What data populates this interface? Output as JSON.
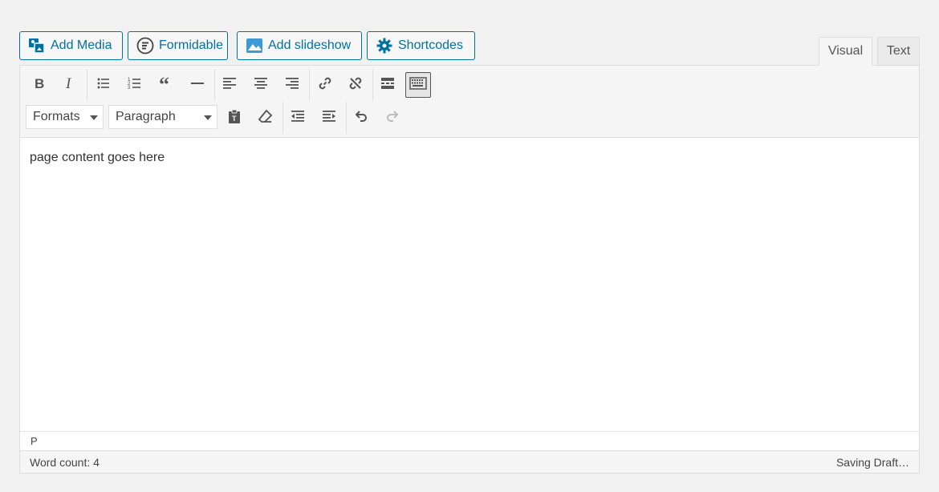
{
  "media_buttons": {
    "add_media": "Add Media",
    "formidable": "Formidable",
    "add_slideshow": "Add slideshow",
    "shortcodes": "Shortcodes"
  },
  "tabs": {
    "visual": "Visual",
    "text": "Text"
  },
  "toolbar": {
    "formats_select": "Formats",
    "paragraph_select": "Paragraph",
    "row1_icons": [
      "bold-icon",
      "italic-icon",
      "bulleted-list-icon",
      "numbered-list-icon",
      "blockquote-icon",
      "horizontal-line-icon",
      "align-left-icon",
      "align-center-icon",
      "align-right-icon",
      "insert-link-icon",
      "remove-link-icon",
      "read-more-icon",
      "toolbar-toggle-icon"
    ],
    "row2_icons": [
      "paste-as-text-icon",
      "clear-formatting-icon",
      "outdent-icon",
      "indent-icon",
      "undo-icon",
      "redo-icon"
    ]
  },
  "editor": {
    "content": "page content goes here"
  },
  "path": "P",
  "status": {
    "word_count": "Word count: 4",
    "save_status": "Saving Draft…"
  },
  "colors": {
    "accent": "#0071a1",
    "background": "#f1f1f1",
    "toolbar_bg": "#f5f5f5"
  }
}
